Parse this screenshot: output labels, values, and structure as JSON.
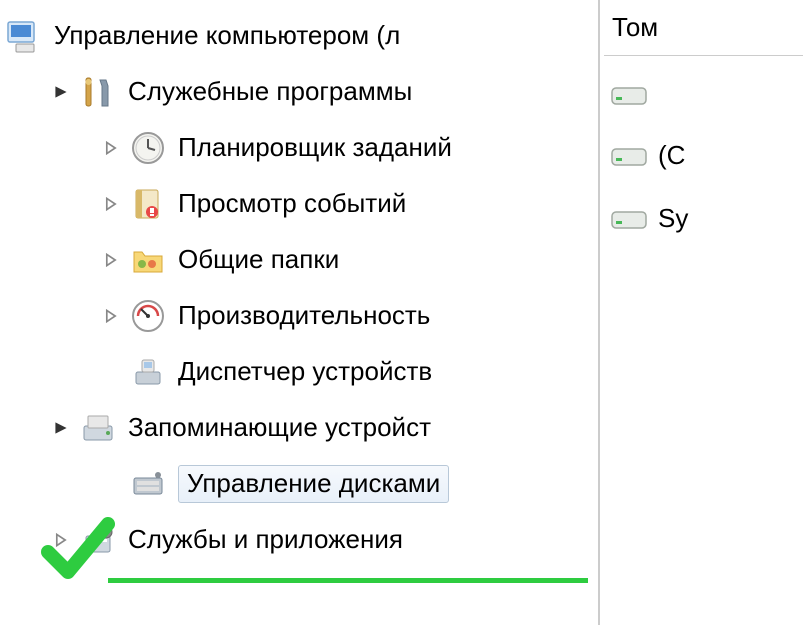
{
  "tree": {
    "root": "Управление компьютером (л",
    "utilities": "Служебные программы",
    "scheduler": "Планировщик заданий",
    "eventviewer": "Просмотр событий",
    "sharedfolders": "Общие папки",
    "performance": "Производительность",
    "devicemanager": "Диспетчер устройств",
    "storage": "Запоминающие устройст",
    "diskmgmt": "Управление дисками",
    "services": "Службы и приложения"
  },
  "volumes": {
    "header": "Том",
    "item1": "",
    "item2": "(C",
    "item3": "Sy"
  }
}
